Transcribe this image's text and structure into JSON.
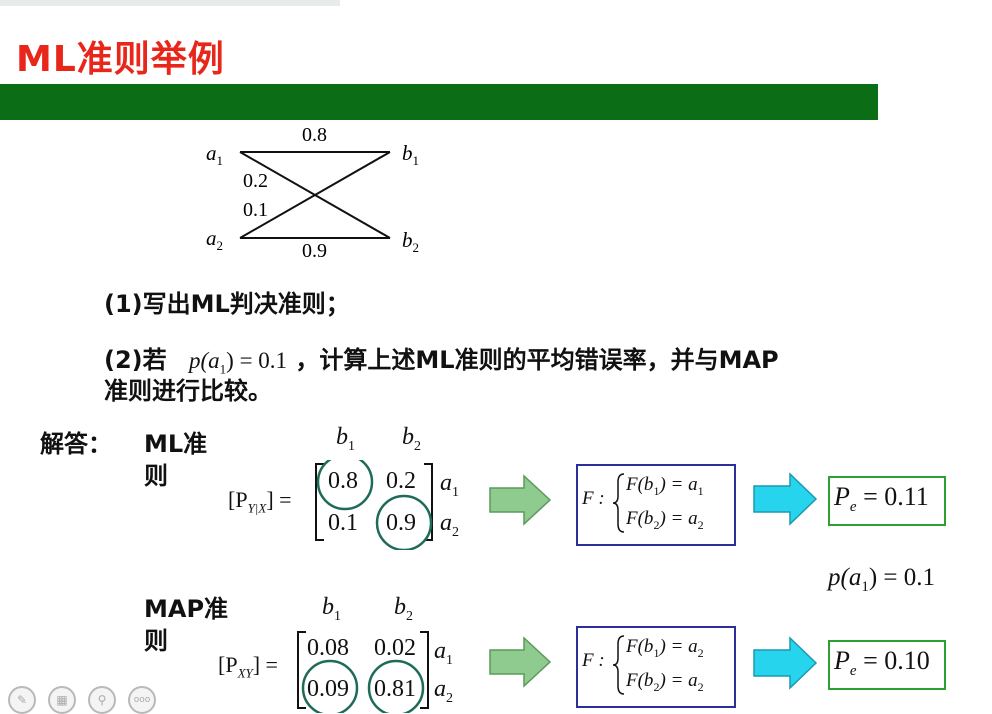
{
  "title": "ML准则举例",
  "diagram": {
    "a1": "a",
    "a1_sub": "1",
    "a2": "a",
    "a2_sub": "2",
    "b1": "b",
    "b1_sub": "1",
    "b2": "b",
    "b2_sub": "2",
    "w_a1b1": "0.8",
    "w_a1b2": "0.2",
    "w_a2b1": "0.1",
    "w_a2b2": "0.9"
  },
  "questions": {
    "q1": "(1)写出ML判决准则；",
    "q2_prefix": "(2)若",
    "q2_formula": "p(a",
    "q2_formula_sub": "1",
    "q2_formula_end": ") = 0.1",
    "q2_suffix": "，计算上述ML准则的平均错误率，并与MAP",
    "q2_line2": "准则进行比较。"
  },
  "answer": {
    "label": "解答：",
    "ml_label_1": "ML准",
    "ml_label_2": "则",
    "map_label_1": "MAP准",
    "map_label_2": "则"
  },
  "ml": {
    "col1": "b",
    "col1_sub": "1",
    "col2": "b",
    "col2_sub": "2",
    "row1": "a",
    "row1_sub": "1",
    "row2": "a",
    "row2_sub": "2",
    "matrix_name": "[P",
    "matrix_sub": "Y|X",
    "matrix_end": "] =",
    "m11": "0.8",
    "m12": "0.2",
    "m21": "0.1",
    "m22": "0.9",
    "rule_F": "F :",
    "rule1_lhs": "F(b",
    "rule1_sub": "1",
    "rule1_rhs": ") = a",
    "rule1_rhs_sub": "1",
    "rule2_lhs": "F(b",
    "rule2_sub": "2",
    "rule2_rhs": ") = a",
    "rule2_rhs_sub": "2",
    "pe": "P",
    "pe_sub": "e",
    "pe_val": " = 0.11"
  },
  "prior": {
    "text": "p(a",
    "sub": "1",
    "end": ") = 0.1"
  },
  "map": {
    "col1": "b",
    "col1_sub": "1",
    "col2": "b",
    "col2_sub": "2",
    "row1": "a",
    "row1_sub": "1",
    "row2": "a",
    "row2_sub": "2",
    "matrix_name": "[P",
    "matrix_sub": "XY",
    "matrix_end": "] =",
    "m11": "0.08",
    "m12": "0.02",
    "m21": "0.09",
    "m22": "0.81",
    "rule_F": "F :",
    "rule1_lhs": "F(b",
    "rule1_sub": "1",
    "rule1_rhs": ") = a",
    "rule1_rhs_sub": "2",
    "rule2_lhs": "F(b",
    "rule2_sub": "2",
    "rule2_rhs": ") = a",
    "rule2_rhs_sub": "2",
    "pe": "P",
    "pe_sub": "e",
    "pe_val": " = 0.10"
  },
  "toolbar": {
    "icons": [
      "pen-icon",
      "slides-icon",
      "zoom-icon",
      "more-icon"
    ],
    "more_label": "ooo"
  },
  "colors": {
    "title_red": "#e8261a",
    "green_bar": "#0b6e16",
    "orange_label": "#d98a2b",
    "blue_label": "#1a2ea8",
    "red_value": "#d11818",
    "circle_teal": "#1f6b5a",
    "arrow_green": "#8fca8f",
    "arrow_cyan": "#27d4ee"
  }
}
